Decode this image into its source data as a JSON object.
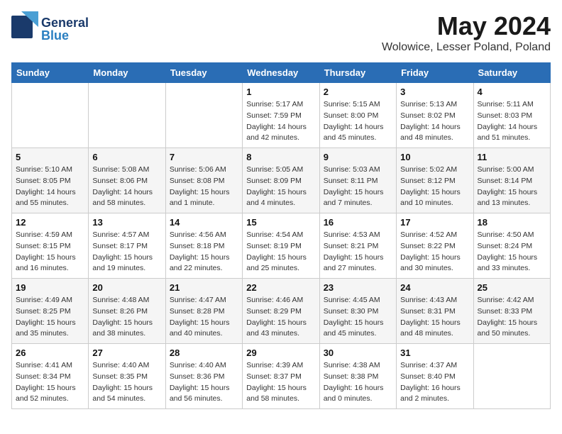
{
  "header": {
    "logo_general": "General",
    "logo_blue": "Blue",
    "title": "May 2024",
    "location": "Wolowice, Lesser Poland, Poland"
  },
  "weekdays": [
    "Sunday",
    "Monday",
    "Tuesday",
    "Wednesday",
    "Thursday",
    "Friday",
    "Saturday"
  ],
  "weeks": [
    [
      {
        "day": "",
        "sunrise": "",
        "sunset": "",
        "daylight": ""
      },
      {
        "day": "",
        "sunrise": "",
        "sunset": "",
        "daylight": ""
      },
      {
        "day": "",
        "sunrise": "",
        "sunset": "",
        "daylight": ""
      },
      {
        "day": "1",
        "sunrise": "Sunrise: 5:17 AM",
        "sunset": "Sunset: 7:59 PM",
        "daylight": "Daylight: 14 hours and 42 minutes."
      },
      {
        "day": "2",
        "sunrise": "Sunrise: 5:15 AM",
        "sunset": "Sunset: 8:00 PM",
        "daylight": "Daylight: 14 hours and 45 minutes."
      },
      {
        "day": "3",
        "sunrise": "Sunrise: 5:13 AM",
        "sunset": "Sunset: 8:02 PM",
        "daylight": "Daylight: 14 hours and 48 minutes."
      },
      {
        "day": "4",
        "sunrise": "Sunrise: 5:11 AM",
        "sunset": "Sunset: 8:03 PM",
        "daylight": "Daylight: 14 hours and 51 minutes."
      }
    ],
    [
      {
        "day": "5",
        "sunrise": "Sunrise: 5:10 AM",
        "sunset": "Sunset: 8:05 PM",
        "daylight": "Daylight: 14 hours and 55 minutes."
      },
      {
        "day": "6",
        "sunrise": "Sunrise: 5:08 AM",
        "sunset": "Sunset: 8:06 PM",
        "daylight": "Daylight: 14 hours and 58 minutes."
      },
      {
        "day": "7",
        "sunrise": "Sunrise: 5:06 AM",
        "sunset": "Sunset: 8:08 PM",
        "daylight": "Daylight: 15 hours and 1 minute."
      },
      {
        "day": "8",
        "sunrise": "Sunrise: 5:05 AM",
        "sunset": "Sunset: 8:09 PM",
        "daylight": "Daylight: 15 hours and 4 minutes."
      },
      {
        "day": "9",
        "sunrise": "Sunrise: 5:03 AM",
        "sunset": "Sunset: 8:11 PM",
        "daylight": "Daylight: 15 hours and 7 minutes."
      },
      {
        "day": "10",
        "sunrise": "Sunrise: 5:02 AM",
        "sunset": "Sunset: 8:12 PM",
        "daylight": "Daylight: 15 hours and 10 minutes."
      },
      {
        "day": "11",
        "sunrise": "Sunrise: 5:00 AM",
        "sunset": "Sunset: 8:14 PM",
        "daylight": "Daylight: 15 hours and 13 minutes."
      }
    ],
    [
      {
        "day": "12",
        "sunrise": "Sunrise: 4:59 AM",
        "sunset": "Sunset: 8:15 PM",
        "daylight": "Daylight: 15 hours and 16 minutes."
      },
      {
        "day": "13",
        "sunrise": "Sunrise: 4:57 AM",
        "sunset": "Sunset: 8:17 PM",
        "daylight": "Daylight: 15 hours and 19 minutes."
      },
      {
        "day": "14",
        "sunrise": "Sunrise: 4:56 AM",
        "sunset": "Sunset: 8:18 PM",
        "daylight": "Daylight: 15 hours and 22 minutes."
      },
      {
        "day": "15",
        "sunrise": "Sunrise: 4:54 AM",
        "sunset": "Sunset: 8:19 PM",
        "daylight": "Daylight: 15 hours and 25 minutes."
      },
      {
        "day": "16",
        "sunrise": "Sunrise: 4:53 AM",
        "sunset": "Sunset: 8:21 PM",
        "daylight": "Daylight: 15 hours and 27 minutes."
      },
      {
        "day": "17",
        "sunrise": "Sunrise: 4:52 AM",
        "sunset": "Sunset: 8:22 PM",
        "daylight": "Daylight: 15 hours and 30 minutes."
      },
      {
        "day": "18",
        "sunrise": "Sunrise: 4:50 AM",
        "sunset": "Sunset: 8:24 PM",
        "daylight": "Daylight: 15 hours and 33 minutes."
      }
    ],
    [
      {
        "day": "19",
        "sunrise": "Sunrise: 4:49 AM",
        "sunset": "Sunset: 8:25 PM",
        "daylight": "Daylight: 15 hours and 35 minutes."
      },
      {
        "day": "20",
        "sunrise": "Sunrise: 4:48 AM",
        "sunset": "Sunset: 8:26 PM",
        "daylight": "Daylight: 15 hours and 38 minutes."
      },
      {
        "day": "21",
        "sunrise": "Sunrise: 4:47 AM",
        "sunset": "Sunset: 8:28 PM",
        "daylight": "Daylight: 15 hours and 40 minutes."
      },
      {
        "day": "22",
        "sunrise": "Sunrise: 4:46 AM",
        "sunset": "Sunset: 8:29 PM",
        "daylight": "Daylight: 15 hours and 43 minutes."
      },
      {
        "day": "23",
        "sunrise": "Sunrise: 4:45 AM",
        "sunset": "Sunset: 8:30 PM",
        "daylight": "Daylight: 15 hours and 45 minutes."
      },
      {
        "day": "24",
        "sunrise": "Sunrise: 4:43 AM",
        "sunset": "Sunset: 8:31 PM",
        "daylight": "Daylight: 15 hours and 48 minutes."
      },
      {
        "day": "25",
        "sunrise": "Sunrise: 4:42 AM",
        "sunset": "Sunset: 8:33 PM",
        "daylight": "Daylight: 15 hours and 50 minutes."
      }
    ],
    [
      {
        "day": "26",
        "sunrise": "Sunrise: 4:41 AM",
        "sunset": "Sunset: 8:34 PM",
        "daylight": "Daylight: 15 hours and 52 minutes."
      },
      {
        "day": "27",
        "sunrise": "Sunrise: 4:40 AM",
        "sunset": "Sunset: 8:35 PM",
        "daylight": "Daylight: 15 hours and 54 minutes."
      },
      {
        "day": "28",
        "sunrise": "Sunrise: 4:40 AM",
        "sunset": "Sunset: 8:36 PM",
        "daylight": "Daylight: 15 hours and 56 minutes."
      },
      {
        "day": "29",
        "sunrise": "Sunrise: 4:39 AM",
        "sunset": "Sunset: 8:37 PM",
        "daylight": "Daylight: 15 hours and 58 minutes."
      },
      {
        "day": "30",
        "sunrise": "Sunrise: 4:38 AM",
        "sunset": "Sunset: 8:38 PM",
        "daylight": "Daylight: 16 hours and 0 minutes."
      },
      {
        "day": "31",
        "sunrise": "Sunrise: 4:37 AM",
        "sunset": "Sunset: 8:40 PM",
        "daylight": "Daylight: 16 hours and 2 minutes."
      },
      {
        "day": "",
        "sunrise": "",
        "sunset": "",
        "daylight": ""
      }
    ]
  ]
}
